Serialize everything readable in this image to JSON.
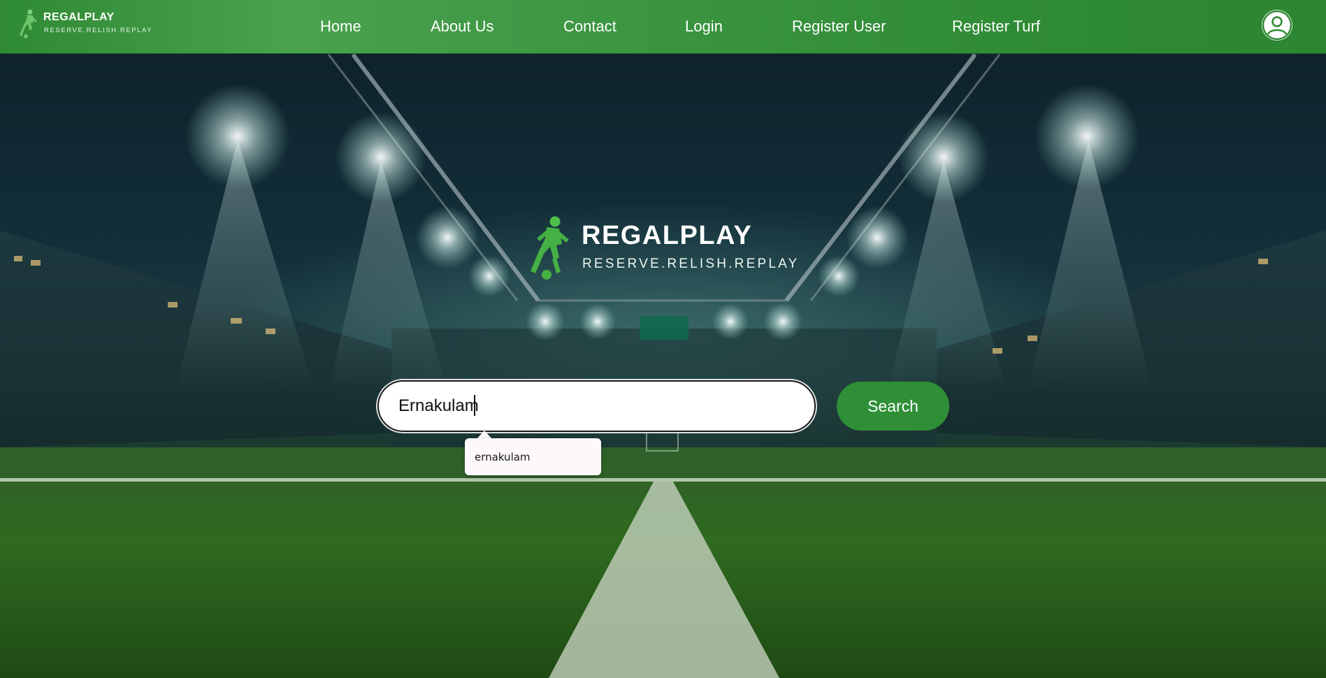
{
  "header": {
    "brand": {
      "title": "REGALPLAY",
      "tagline": "RESERVE.RELISH.REPLAY"
    },
    "nav": [
      {
        "label": "Home"
      },
      {
        "label": "About Us"
      },
      {
        "label": "Contact"
      },
      {
        "label": "Login"
      },
      {
        "label": "Register User"
      },
      {
        "label": "Register Turf"
      }
    ],
    "profile_icon": "user-circle-icon"
  },
  "hero": {
    "title": "REGALPLAY",
    "tagline": "RESERVE.RELISH.REPLAY"
  },
  "search": {
    "value": "Ernakulam",
    "button_label": "Search",
    "suggestions": [
      "ernakulam"
    ]
  },
  "colors": {
    "primary_green": "#2f8f36",
    "header_green": "#3a9440",
    "white": "#ffffff"
  }
}
